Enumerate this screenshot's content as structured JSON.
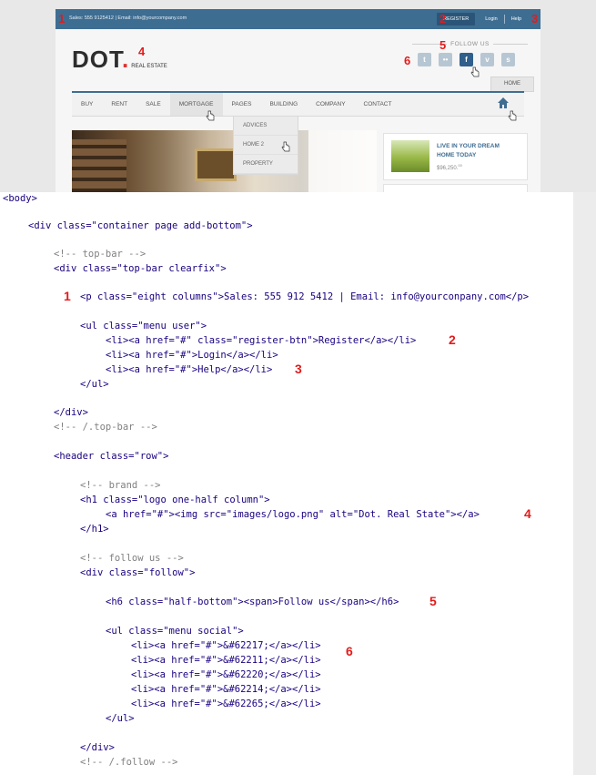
{
  "topbar": {
    "contact": "Sales: 555 9125412 | Email: info@yourcompany.com",
    "register": "REGISTER",
    "login": "Login",
    "help": "Help"
  },
  "logo": {
    "main": "DOT",
    "dot": ".",
    "sub": "REAL ESTATE"
  },
  "follow": {
    "title": "FOLLOW US",
    "icons": [
      "twitter-icon",
      "flickr-icon",
      "facebook-icon",
      "vimeo-icon",
      "skype-icon"
    ],
    "glyphs": [
      "t",
      "••",
      "f",
      "v",
      "s"
    ]
  },
  "home_button": "HOME",
  "nav": [
    "BUY",
    "RENT",
    "SALE",
    "MORTGAGE",
    "PAGES",
    "BUILDING",
    "COMPANY",
    "CONTACT"
  ],
  "submenu": [
    "ADVICES",
    "HOME 2",
    "PROPERTY"
  ],
  "card": {
    "title": "LIVE IN YOUR DREAM HOME TODAY",
    "price": "$96,250.",
    "cents": "00"
  },
  "markers": {
    "m1": "1",
    "m2": "2",
    "m3": "3",
    "m4": "4",
    "m5": "5",
    "m6": "6"
  },
  "code": {
    "body": "<body>",
    "container": "<div class=\"container page add-bottom\">",
    "c_topbar": "<!-- top-bar -->",
    "topbar_div": "<div class=\"top-bar clearfix\">",
    "p_line": "<p class=\"eight columns\">Sales: 555 912 5412 | Email: info@yourconpany.com</p>",
    "ul_user": "<ul class=\"menu user\">",
    "li_register": "<li><a href=\"#\" class=\"register-btn\">Register</a></li>",
    "li_login": "<li><a href=\"#\">Login</a></li>",
    "li_help": "<li><a href=\"#\">Help</a></li>",
    "ul_close": "</ul>",
    "div_close": "</div>",
    "c_topbar_end": "<!-- /.top-bar -->",
    "header": "<header class=\"row\">",
    "c_brand": "<!-- brand -->",
    "h1": "<h1 class=\"logo one-half column\">",
    "img_line": "<a href=\"#\"><img src=\"images/logo.png\" alt=\"Dot. Real State\"></a>",
    "h1_close": "</h1>",
    "c_follow": "<!-- follow us -->",
    "follow_div": "<div class=\"follow\">",
    "h6": "<h6 class=\"half-bottom\"><span>Follow us</span></h6>",
    "ul_social": "<ul class=\"menu social\">",
    "li_s1": "<li><a href=\"#\">&#62217;</a></li>",
    "li_s2": "<li><a href=\"#\">&#62211;</a></li>",
    "li_s3": "<li><a href=\"#\">&#62220;</a></li>",
    "li_s4": "<li><a href=\"#\">&#62214;</a></li>",
    "li_s5": "<li><a href=\"#\">&#62265;</a></li>",
    "ul_close2": "</ul>",
    "div_close2": "</div>",
    "c_follow_end": "<!-- /.follow -->"
  }
}
